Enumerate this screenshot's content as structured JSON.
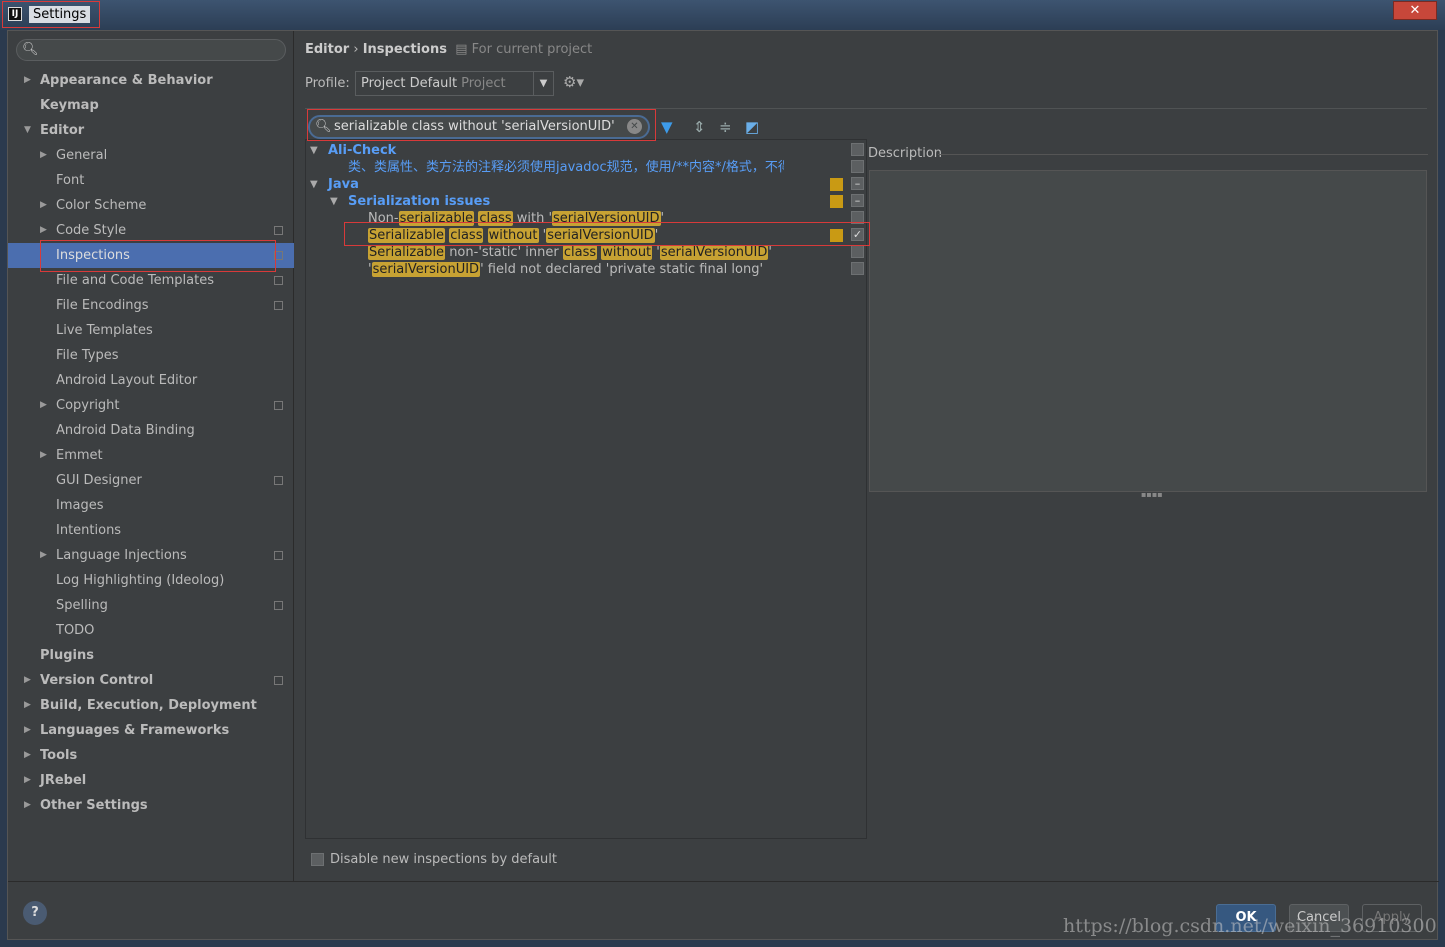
{
  "window": {
    "title": "Settings",
    "close": "✕"
  },
  "search": {
    "placeholder": ""
  },
  "sidebar": {
    "items": [
      {
        "label": "Appearance & Behavior",
        "level": 0,
        "arrow": "right",
        "bold": true
      },
      {
        "label": "Keymap",
        "level": 0,
        "bold": true
      },
      {
        "label": "Editor",
        "level": 0,
        "arrow": "down",
        "bold": true
      },
      {
        "label": "General",
        "level": 1,
        "arrow": "right"
      },
      {
        "label": "Font",
        "level": 1
      },
      {
        "label": "Color Scheme",
        "level": 1,
        "arrow": "right"
      },
      {
        "label": "Code Style",
        "level": 1,
        "arrow": "right",
        "copy": true
      },
      {
        "label": "Inspections",
        "level": 1,
        "copy": true,
        "selected": true
      },
      {
        "label": "File and Code Templates",
        "level": 1,
        "copy": true
      },
      {
        "label": "File Encodings",
        "level": 1,
        "copy": true
      },
      {
        "label": "Live Templates",
        "level": 1
      },
      {
        "label": "File Types",
        "level": 1
      },
      {
        "label": "Android Layout Editor",
        "level": 1
      },
      {
        "label": "Copyright",
        "level": 1,
        "arrow": "right",
        "copy": true
      },
      {
        "label": "Android Data Binding",
        "level": 1
      },
      {
        "label": "Emmet",
        "level": 1,
        "arrow": "right"
      },
      {
        "label": "GUI Designer",
        "level": 1,
        "copy": true
      },
      {
        "label": "Images",
        "level": 1
      },
      {
        "label": "Intentions",
        "level": 1
      },
      {
        "label": "Language Injections",
        "level": 1,
        "arrow": "right",
        "copy": true
      },
      {
        "label": "Log Highlighting (Ideolog)",
        "level": 1
      },
      {
        "label": "Spelling",
        "level": 1,
        "copy": true
      },
      {
        "label": "TODO",
        "level": 1
      },
      {
        "label": "Plugins",
        "level": 0,
        "bold": true
      },
      {
        "label": "Version Control",
        "level": 0,
        "arrow": "right",
        "bold": true,
        "copy": true
      },
      {
        "label": "Build, Execution, Deployment",
        "level": 0,
        "arrow": "right",
        "bold": true
      },
      {
        "label": "Languages & Frameworks",
        "level": 0,
        "arrow": "right",
        "bold": true
      },
      {
        "label": "Tools",
        "level": 0,
        "arrow": "right",
        "bold": true
      },
      {
        "label": "JRebel",
        "level": 0,
        "arrow": "right",
        "bold": true
      },
      {
        "label": "Other Settings",
        "level": 0,
        "arrow": "right",
        "bold": true
      }
    ]
  },
  "breadcrumb": {
    "parent": "Editor",
    "sep": "›",
    "current": "Inspections",
    "scope": "For current project"
  },
  "profile": {
    "label": "Profile:",
    "value": "Project Default",
    "sub": "Project"
  },
  "filter": {
    "value": "serializable class without   'serialVersionUID'"
  },
  "tree": [
    {
      "type": "group",
      "level": 0,
      "label": "Ali-Check",
      "cb": "empty"
    },
    {
      "type": "item",
      "level": 1,
      "blue": true,
      "segments": [
        {
          "t": "类、类属性、类方法的注释必须使用javadoc规范，使用/**内容*/格式，不得使用//xxx方式"
        }
      ],
      "cb": "empty"
    },
    {
      "type": "group",
      "level": 0,
      "label": "Java",
      "sev": true,
      "cb": "partial"
    },
    {
      "type": "group",
      "level": 1,
      "label": "Serialization issues",
      "sev": true,
      "cb": "partial"
    },
    {
      "type": "item",
      "level": 2,
      "segments": [
        {
          "t": "Non-"
        },
        {
          "t": "serializable",
          "h": 1
        },
        {
          "t": " "
        },
        {
          "t": "class",
          "h": 1
        },
        {
          "t": " with '"
        },
        {
          "t": "serialVersionUID",
          "h": 1
        },
        {
          "t": "'"
        }
      ],
      "cb": "empty"
    },
    {
      "type": "item",
      "level": 2,
      "segments": [
        {
          "t": "Serializable",
          "h": 1
        },
        {
          "t": " "
        },
        {
          "t": "class",
          "h": 1
        },
        {
          "t": " "
        },
        {
          "t": "without",
          "h": 1
        },
        {
          "t": " '"
        },
        {
          "t": "serialVersionUID",
          "h": 1
        },
        {
          "t": "'"
        }
      ],
      "sev": true,
      "cb": "checked"
    },
    {
      "type": "item",
      "level": 2,
      "segments": [
        {
          "t": "Serializable",
          "h": 1
        },
        {
          "t": " non-'static' inner "
        },
        {
          "t": "class",
          "h": 1
        },
        {
          "t": " "
        },
        {
          "t": "without",
          "h": 1
        },
        {
          "t": " '"
        },
        {
          "t": "serialVersionUID",
          "h": 1
        },
        {
          "t": "'"
        }
      ],
      "cb": "empty"
    },
    {
      "type": "item",
      "level": 2,
      "segments": [
        {
          "t": "'"
        },
        {
          "t": "serialVersionUID",
          "h": 1
        },
        {
          "t": "' field not declared 'private static final long'"
        }
      ],
      "cb": "empty"
    }
  ],
  "description": {
    "label": "Description"
  },
  "options": {
    "disable_new": "Disable new inspections by default"
  },
  "footer": {
    "help": "?",
    "ok": "OK",
    "cancel": "Cancel",
    "apply": "Apply"
  },
  "watermark": "https://blog.csdn.net/weixin_36910300",
  "colors": {
    "accent": "#4b6eaf",
    "group": "#589df6",
    "highlight": "#c7a233",
    "severity": "#c99a14"
  }
}
